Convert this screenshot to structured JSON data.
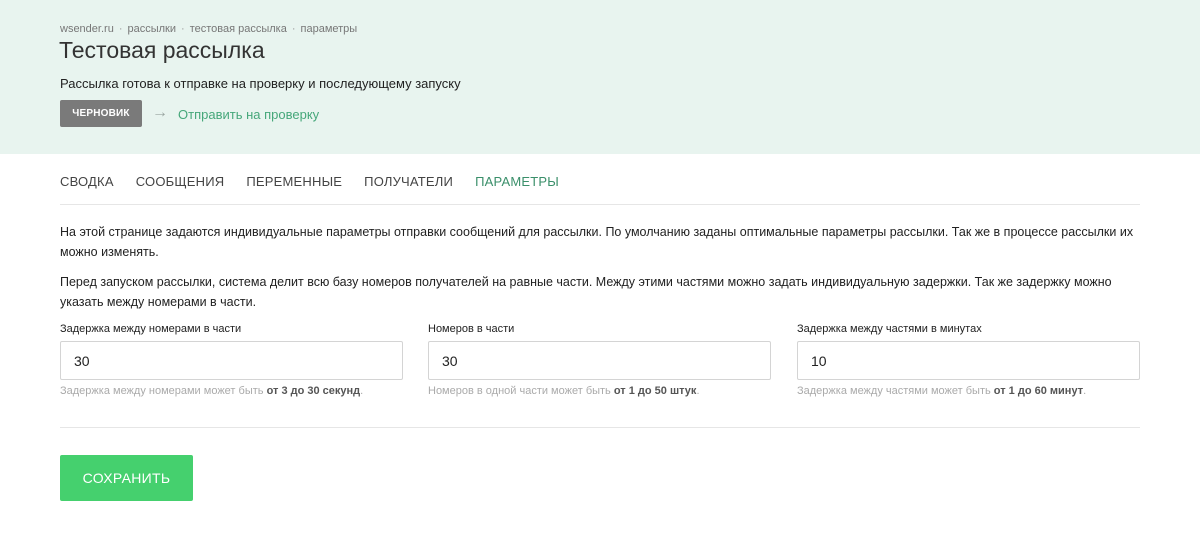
{
  "breadcrumb": {
    "items": [
      "wsender.ru",
      "рассылки",
      "тестовая рассылка",
      "параметры"
    ],
    "separator": "·"
  },
  "header": {
    "title": "Тестовая рассылка",
    "status_text": "Рассылка готова к отправке на проверку и последующему запуску",
    "badge_label": "ЧЕРНОВИК",
    "arrow": "→",
    "review_link": "Отправить на проверку"
  },
  "tabs": [
    {
      "label": "СВОДКА",
      "active": false
    },
    {
      "label": "СООБЩЕНИЯ",
      "active": false
    },
    {
      "label": "ПЕРЕМЕННЫЕ",
      "active": false
    },
    {
      "label": "ПОЛУЧАТЕЛИ",
      "active": false
    },
    {
      "label": "ПАРАМЕТРЫ",
      "active": true
    }
  ],
  "description": [
    "На этой странице задаются индивидуальные параметры отправки сообщений для рассылки. По умолчанию заданы оптимальные параметры рассылки. Так же в процессе рассылки их можно изменять.",
    "Перед запуском рассылки, система делит всю базу номеров получателей на равные части. Между этими частями можно задать индивидуальную задержки. Так же задержку можно указать между номерами в части."
  ],
  "fields": [
    {
      "label": "Задержка между номерами в части",
      "value": "30",
      "hint_prefix": "Задержка между номерами может быть ",
      "hint_bold": "от 3 до 30 секунд",
      "hint_suffix": "."
    },
    {
      "label": "Номеров в части",
      "value": "30",
      "hint_prefix": "Номеров в одной части может быть ",
      "hint_bold": "от 1 до 50 штук",
      "hint_suffix": "."
    },
    {
      "label": "Задержка между частями в минутах",
      "value": "10",
      "hint_prefix": "Задержка между частями может быть ",
      "hint_bold": "от 1 до 60 минут",
      "hint_suffix": "."
    }
  ],
  "save_label": "СОХРАНИТЬ",
  "colors": {
    "header_bg": "#e8f4ef",
    "accent": "#3a8f6a",
    "link": "#46a77a",
    "badge_bg": "#7a7a7a",
    "save_bg": "#45d06e"
  }
}
